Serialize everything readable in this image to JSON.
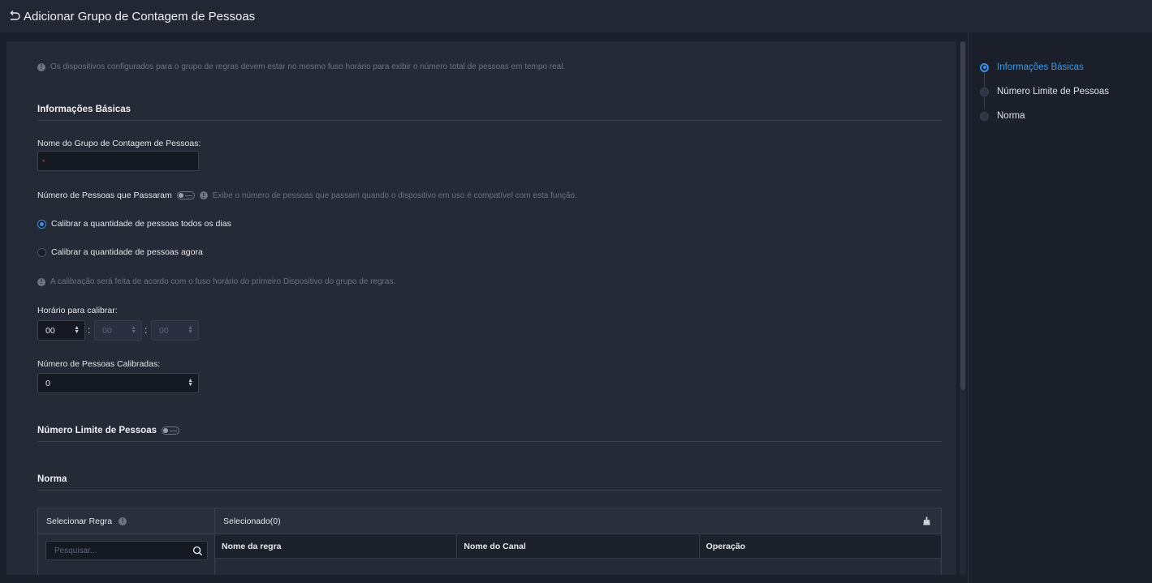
{
  "header": {
    "title": "Adicionar Grupo de Contagem de Pessoas"
  },
  "notice": {
    "text": "Os dispositivos configurados para o grupo de regras devem estar no mesmo fuso horário para exibir o número total de pessoas em tempo real."
  },
  "basic": {
    "section_title": "Informações Básicas",
    "group_name_label": "Nome do Grupo de Contagem de Pessoas:",
    "group_name_value": "",
    "passed_label": "Número de Pessoas que Passaram",
    "passed_info": "Exibe o número de pessoas que passam quando o dispositivo em uso é compatível com esta função.",
    "radio_daily": "Calibrar a quantidade de pessoas todos os dias",
    "radio_now": "Calibrar a quantidade de pessoas agora",
    "calib_info": "A calibração será feita de acordo com o fuso horário do primeiro Dispositivo do grupo de regras.",
    "time_label": "Horário para calibrar:",
    "time_hour": "00",
    "time_min": "00",
    "time_sec": "00",
    "colon": ":",
    "calibrated_label": "Número de Pessoas Calibradas:",
    "calibrated_value": "0"
  },
  "limit": {
    "section_title": "Número Limite de Pessoas"
  },
  "rule": {
    "section_title": "Norma",
    "select_rule_label": "Selecionar Regra",
    "search_placeholder": "Pesquisar...",
    "selected_label": "Selecionado(0)",
    "columns": [
      "Nome da regra",
      "Nome do Canal",
      "Operação"
    ]
  },
  "steps": [
    {
      "label": "Informações Básicas",
      "active": true
    },
    {
      "label": "Número Limite de Pessoas",
      "active": false
    },
    {
      "label": "Norma",
      "active": false
    }
  ],
  "colors": {
    "accent": "#3a8ee6",
    "background": "#1b1f29",
    "panel": "#252a37"
  }
}
